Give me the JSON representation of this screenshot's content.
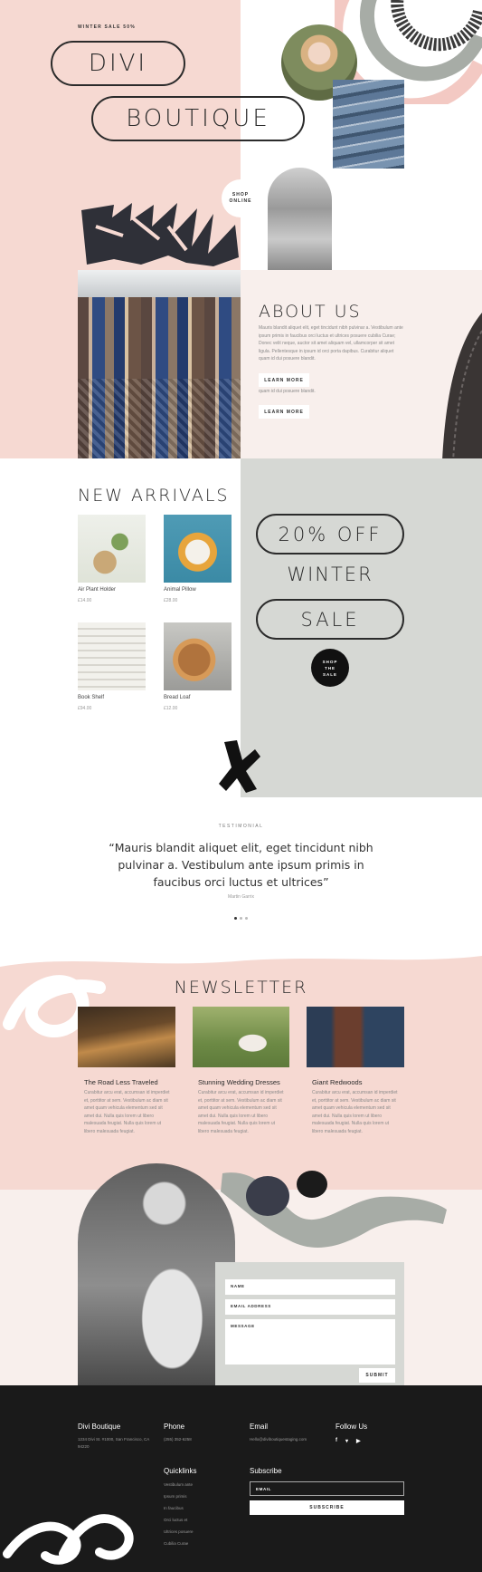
{
  "colors": {
    "pink": "#f6d9d2",
    "light_pink": "#f8efec",
    "sage": "#d6d8d4",
    "dark": "#1b1b1b",
    "footer": "#1a1a1a"
  },
  "hero": {
    "sale_label": "WINTER SALE 50%",
    "title_1": "DIVI",
    "title_2": "BOUTIQUE",
    "shop_button": "SHOP ONLINE"
  },
  "about": {
    "heading": "ABOUT US",
    "body": "Mauris blandit aliquet elit, eget tincidunt nibh pulvinar a. Vestibulum ante ipsum primis in faucibus orci luctus et ultrices posuere cubilia Curae; Donec velit neque, auctor sit amet aliquam vel, ullamcorper sit amet ligula. Pellentesque in ipsum id orci porta dapibus. Curabitur aliquet quam id dui posuere blandit.",
    "button_1": "LEARN MORE",
    "body_2": "quam id dui posuere blandit.",
    "button_2": "LEARN MORE"
  },
  "arrivals": {
    "heading": "NEW ARRIVALS",
    "products": [
      {
        "name": "Air Plant Holder",
        "price": "£14.00",
        "icon": "plant-image"
      },
      {
        "name": "Animal Pillow",
        "price": "£28.00",
        "icon": "pillow-image"
      },
      {
        "name": "Book Shelf",
        "price": "£94.00",
        "icon": "books-image"
      },
      {
        "name": "Bread Loaf",
        "price": "£12.00",
        "icon": "bread-image"
      }
    ]
  },
  "promo": {
    "line_1": "20% OFF",
    "line_2": "WINTER",
    "line_3": "SALE",
    "button": "SHOP THE SALE"
  },
  "testimonial": {
    "label": "TESTIMONIAL",
    "quote": "“Mauris blandit aliquet elit, eget tincidunt nibh pulvinar a. Vestibulum ante ipsum primis in faucibus orci luctus et ultrices”",
    "author": "Martin Garrix"
  },
  "newsletter": {
    "heading": "NEWSLETTER",
    "posts": [
      {
        "title": "The Road Less Traveled",
        "excerpt": "Curabitur arcu erat, accumsan id imperdiet et, porttitor at sem. Vestibulum ac diam sit amet quam vehicula elementum sed sit amet dui. Nulla quis lorem ut libero malesuada feugiat. Nulla quis lorem ut libero malesuada feugiat."
      },
      {
        "title": "Stunning Wedding Dresses",
        "excerpt": "Curabitur arcu erat, accumsan id imperdiet et, porttitor at sem. Vestibulum ac diam sit amet quam vehicula elementum sed sit amet dui. Nulla quis lorem ut libero malesuada feugiat. Nulla quis lorem ut libero malesuada feugiat."
      },
      {
        "title": "Giant Redwoods",
        "excerpt": "Curabitur arcu erat, accumsan id imperdiet et, porttitor at sem. Vestibulum ac diam sit amet quam vehicula elementum sed sit amet dui. Nulla quis lorem ut libero malesuada feugiat. Nulla quis lorem ut libero malesuada feugiat."
      }
    ]
  },
  "contact": {
    "name_placeholder": "NAME",
    "email_placeholder": "EMAIL ADDRESS",
    "message_placeholder": "MESSAGE",
    "submit": "SUBMIT"
  },
  "footer": {
    "brand": "Divi Boutique",
    "address": "1234 Divi St. #1000, San Francisco, CA 94220",
    "phone_heading": "Phone",
    "phone": "(255) 352-6258",
    "email_heading": "Email",
    "email": "Hello@diviboutiquestaging.com",
    "follow_heading": "Follow Us",
    "social": [
      "facebook-icon",
      "twitter-icon",
      "youtube-icon"
    ],
    "quicklinks_heading": "Quicklinks",
    "quicklinks": [
      "Vestibulum ante",
      "Ipsum primis",
      "In faucibus",
      "Orci luctus et",
      "Ultrices posuere",
      "Cubilia Curae"
    ],
    "subscribe_heading": "Subscribe",
    "subscribe_placeholder": "EMAIL",
    "subscribe_button": "SUBSCRIBE"
  }
}
